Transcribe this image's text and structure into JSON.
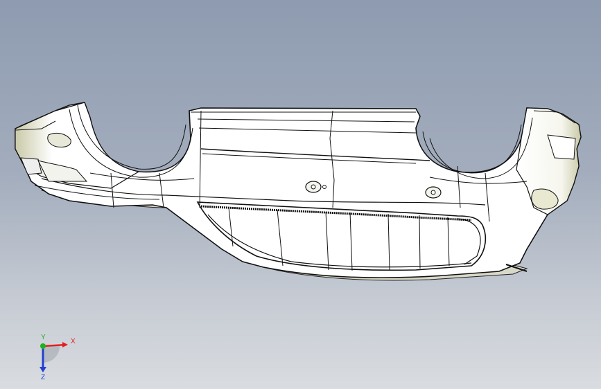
{
  "viewport": {
    "model": "bumper-part",
    "background_top": "#8e9bb0",
    "background_bottom": "#d9dce0",
    "edge_color": "#1a1a1a",
    "face_color": "#ffffff"
  },
  "triad": {
    "x_label": "X",
    "y_label": "Y",
    "z_label": "Z",
    "x_color": "#e02020",
    "y_color": "#20b020",
    "z_color": "#2040d0"
  }
}
